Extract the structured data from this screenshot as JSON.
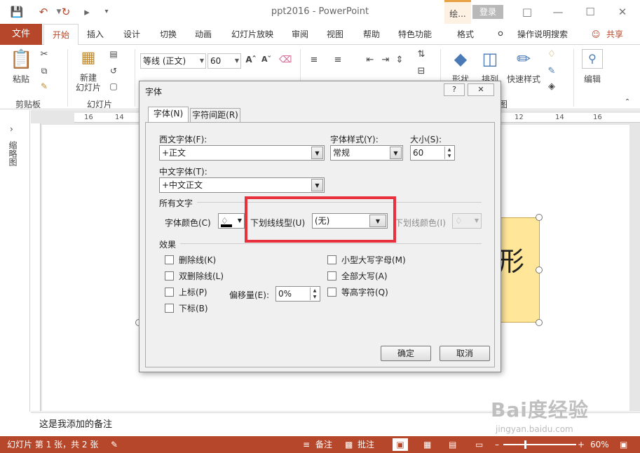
{
  "window": {
    "title": "ppt2016 - PowerPoint",
    "draw_tab": "绘...",
    "login": "登录"
  },
  "tabs": [
    "开始",
    "插入",
    "设计",
    "切换",
    "动画",
    "幻灯片放映",
    "审阅",
    "视图",
    "帮助",
    "特色功能",
    "格式"
  ],
  "file_tab": "文件",
  "tell_me": "操作说明搜索",
  "share": "共享",
  "ribbon": {
    "paste": "粘贴",
    "clipboard_group": "剪贴板",
    "new_slide": "新建\n幻灯片",
    "slides_group": "幻灯片",
    "font_name": "等线 (正文)",
    "font_size": "60",
    "shapes": "形状",
    "arrange": "排列",
    "quick_styles": "快速样式",
    "edit": "编辑",
    "drawing_group": "图"
  },
  "left_panel_label": "缩略图",
  "ruler_numbers": [
    "16",
    "14",
    "12",
    "14",
    "16"
  ],
  "slide_shape_text": "形",
  "notes_text": "这是我添加的备注",
  "status": {
    "slide_info": "幻灯片 第 1 张，共 2 张",
    "notes_btn": "备注",
    "comments_btn": "批注",
    "zoom": "60%"
  },
  "watermark": {
    "brand": "Bai度经验",
    "url": "jingyan.baidu.com"
  },
  "dialog": {
    "title": "字体",
    "help_btn": "?",
    "close_btn": "✕",
    "tab_font": "字体(N)",
    "tab_spacing": "字符间距(R)",
    "western_font_label": "西文字体(F):",
    "western_font_value": "+正文",
    "style_label": "字体样式(Y):",
    "style_value": "常规",
    "size_label": "大小(S):",
    "size_value": "60",
    "chinese_font_label": "中文字体(T):",
    "chinese_font_value": "+中文正文",
    "all_text_label": "所有文字",
    "color_label": "字体颜色(C)",
    "underline_type_label": "下划线线型(U)",
    "underline_type_value": "(无)",
    "underline_color_label": "下划线颜色(I)",
    "effects_label": "效果",
    "strikethrough": "删除线(K)",
    "double_strike": "双删除线(L)",
    "superscript": "上标(P)",
    "subscript": "下标(B)",
    "offset_label": "偏移量(E):",
    "offset_value": "0%",
    "small_caps": "小型大写字母(M)",
    "all_caps": "全部大写(A)",
    "equalize": "等高字符(Q)",
    "ok": "确定",
    "cancel": "取消"
  },
  "colors": {
    "accent": "#b7472a",
    "highlight_box": "#e8313c",
    "shape_fill": "#ffe699"
  }
}
